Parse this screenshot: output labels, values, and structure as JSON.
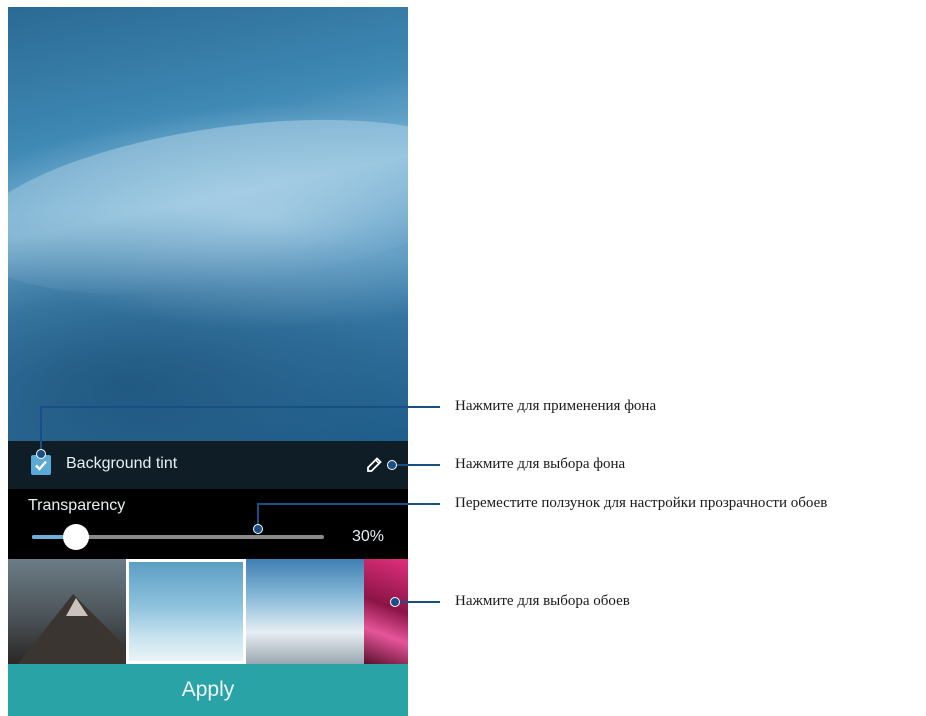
{
  "screen": {
    "background_tint": {
      "label": "Background tint",
      "checked": true,
      "edit_icon": "pencil-icon"
    },
    "transparency": {
      "label": "Transparency",
      "value_text": "30%",
      "value": 0.15
    },
    "wallpapers": [
      {
        "name": "mountain-dusk",
        "selected": false
      },
      {
        "name": "snow-ice",
        "selected": true
      },
      {
        "name": "snowy-peaks",
        "selected": false
      },
      {
        "name": "pink-canyon",
        "selected": false
      }
    ],
    "apply_label": "Apply"
  },
  "callouts": {
    "apply_background": "Нажмите для применения фона",
    "select_background": "Нажмите для выбора фона",
    "transparency_slider": "Переместите ползунок для настройки прозрачности обоев",
    "select_wallpaper": "Нажмите для выбора обоев"
  },
  "colors": {
    "accent": "#2aa3a6",
    "checkbox": "#5aa9d6",
    "callout_line": "#1a4f86"
  }
}
